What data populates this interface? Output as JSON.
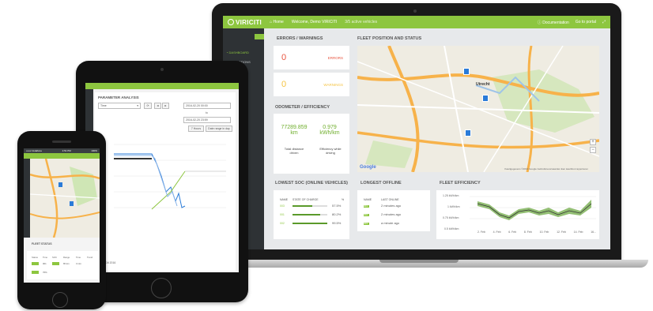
{
  "app": {
    "logo": "VIRICITI",
    "nav_home": "Home",
    "welcome": "Welcome, Demo VIRICITI",
    "subtitle": "3/5 active vehicles",
    "documentation": "Documentation",
    "go_to_portal": "Go to portal"
  },
  "sidebar": {
    "items": [
      "DASHBOARD",
      "OPERATIONS"
    ]
  },
  "errors": {
    "title": "ERRORS / WARNINGS",
    "errors_count": "0",
    "errors_label": "ERRORS",
    "warnings_count": "0",
    "warnings_label": "WARNINGS"
  },
  "odometer": {
    "title": "ODOMETER / EFFICIENCY",
    "distance_value": "77289.859",
    "distance_unit": "km",
    "distance_label": "Total distance driven",
    "efficiency_value": "0.979",
    "efficiency_unit": "kWh/km",
    "efficiency_label": "Efficiency while driving"
  },
  "fleet_map": {
    "title": "FLEET POSITION AND STATUS",
    "city_label": "Utrecht",
    "google": "Google",
    "copyright": "Kaartgegevens ©2016 Google  Gebruiksvoorwaarden  Een kaartfout rapporteren",
    "zoom_in": "+",
    "zoom_out": "−",
    "road_color": "#f7b24a",
    "park_color": "#cfe6b5"
  },
  "lowest_soc": {
    "title": "LOWEST SOC (ONLINE VEHICLES)",
    "headers": [
      "NAME",
      "STATE OF CHARGE",
      "%"
    ],
    "rows": [
      {
        "name": "003",
        "pct": "57.5%",
        "fill": 0.575
      },
      {
        "name": "001",
        "pct": "80.2%",
        "fill": 0.802
      },
      {
        "name": "002",
        "pct": "99.5%",
        "fill": 0.995
      }
    ]
  },
  "longest_offline": {
    "title": "LONGEST OFFLINE",
    "headers": [
      "NAME",
      "LAST ONLINE"
    ],
    "rows": [
      {
        "name": "001",
        "last": "2 minutes ago"
      },
      {
        "name": "002",
        "last": "2 minutes ago"
      },
      {
        "name": "003",
        "last": "a minute ago"
      }
    ]
  },
  "fleet_efficiency": {
    "title": "FLEET EFFICIENCY",
    "y_ticks": [
      "1.25 kWh/km",
      "1 kWh/km",
      "0.75 kWh/km",
      "0.5 kWh/km"
    ],
    "x_ticks": [
      "2. Feb",
      "4. Feb",
      "6. Feb",
      "8. Feb",
      "10. Feb",
      "12. Feb",
      "14. Feb",
      "16..."
    ]
  },
  "tablet": {
    "title": "PARAMETER ANALYSIS",
    "select_value": "Time",
    "date_from": "2016-02-20 00:00",
    "to_label": "to",
    "date_to": "2016-02-20 23:59",
    "btn_refresh": "Refresh",
    "btn_prev": "◄",
    "btn_next": "►",
    "btn_yesterday": "7 Hours",
    "btn_today": "Date range in day",
    "footer": "© ViriCiti 2016"
  },
  "phone": {
    "status_left": "•••oo Vodafone",
    "status_time": "1:51 PM",
    "status_right": "100%",
    "fleet_title": "FLEET STATUS",
    "headers": [
      "Status",
      "Time",
      "SOC",
      "Range",
      "Time",
      "Trend"
    ],
    "row_values": [
      "001",
      "76%",
      "65 km",
      "3 min"
    ]
  },
  "colors": {
    "brand_green": "#8dc63f",
    "sidebar_dark": "#2e3235",
    "error_red": "#e8543f",
    "warning_yellow": "#f5c342"
  }
}
